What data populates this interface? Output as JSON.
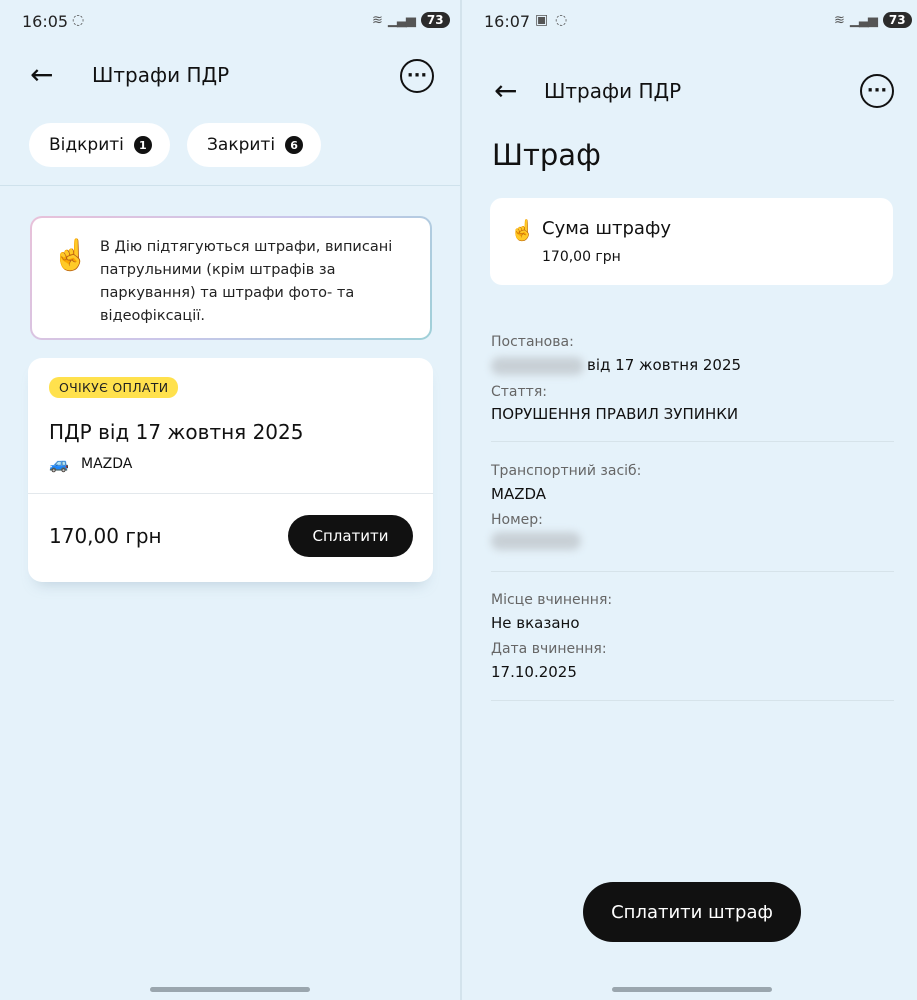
{
  "left": {
    "status": {
      "time": "16:05",
      "battery": "73"
    },
    "header": {
      "title": "Штрафи ПДР",
      "more": "···",
      "back": "←"
    },
    "tabs": [
      {
        "label": "Відкриті",
        "count": "1"
      },
      {
        "label": "Закриті",
        "count": "6"
      }
    ],
    "info": {
      "emoji": "☝️",
      "text": "В Дію підтягуються штрафи, виписані патрульними (крім штрафів за паркування) та штрафи фото- та відеофіксації."
    },
    "fine": {
      "badge": "ОЧІКУЄ ОПЛАТИ",
      "title": "ПДР від 17 жовтня 2025",
      "car_icon": "🚙",
      "car": "MAZDA",
      "amount": "170,00 грн",
      "pay_label": "Сплатити"
    }
  },
  "right": {
    "status": {
      "time": "16:07",
      "battery": "73"
    },
    "header": {
      "title": "Штрафи ПДР",
      "more": "···",
      "back": "←"
    },
    "page_title": "Штраф",
    "sum": {
      "emoji": "☝️",
      "label": "Сума штрафу",
      "value": "170,00 грн"
    },
    "details": {
      "decree_label": "Постанова:",
      "decree_value": "від 17 жовтня 2025",
      "article_label": "Стаття:",
      "article_value": "ПОРУШЕННЯ ПРАВИЛ ЗУПИНКИ",
      "vehicle_label": "Транспортний засіб:",
      "vehicle_value": "MAZDA",
      "number_label": "Номер:",
      "place_label": "Місце вчинення:",
      "place_value": "Не вказано",
      "date_label": "Дата вчинення:",
      "date_value": "17.10.2025"
    },
    "pay_label": "Сплатити штраф"
  }
}
